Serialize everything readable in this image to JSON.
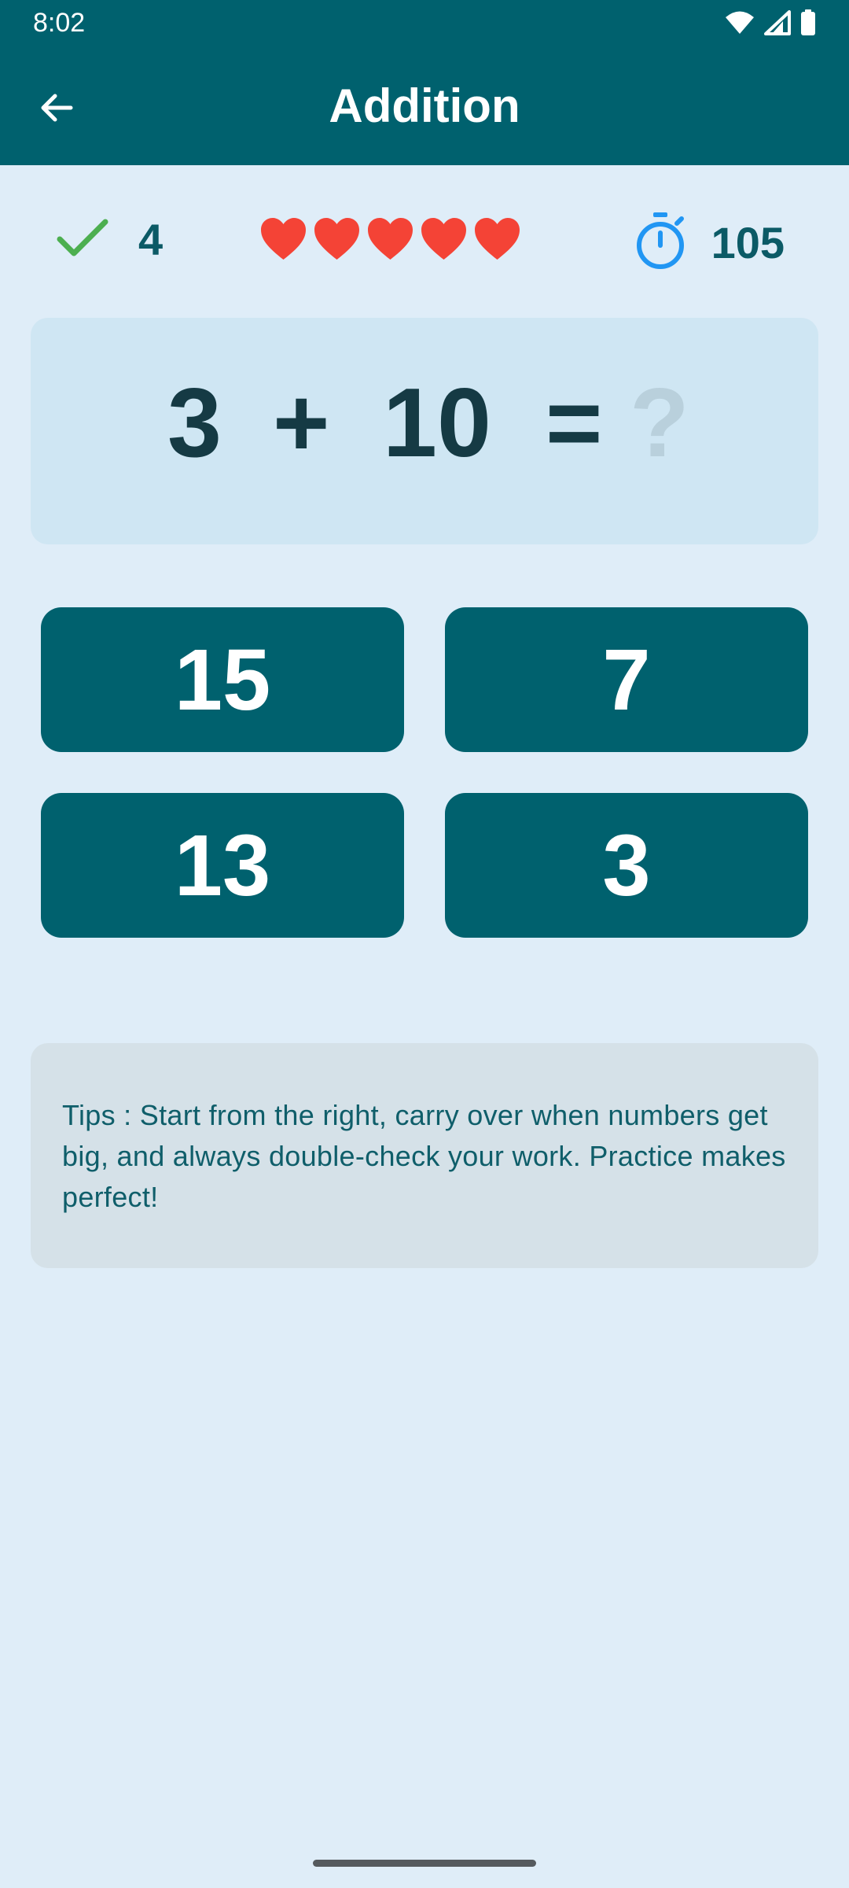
{
  "status_bar": {
    "time": "8:02",
    "icons": [
      "wifi-icon",
      "signal-icon",
      "battery-icon"
    ]
  },
  "app_bar": {
    "back_icon": "arrow-left-icon",
    "title": "Addition"
  },
  "stats": {
    "correct_icon": "check-icon",
    "correct_count": "4",
    "lives": 5,
    "heart_icon": "heart-icon",
    "timer_icon": "stopwatch-icon",
    "timer_value": "105"
  },
  "question": {
    "operand_a": "3",
    "operator": "+",
    "operand_b": "10",
    "equals": "=",
    "unknown": "?"
  },
  "answers": [
    "15",
    "7",
    "13",
    "3"
  ],
  "tips": {
    "text": "Tips : Start from the right, carry over when numbers get big, and always double-check your work. Practice makes perfect!"
  },
  "colors": {
    "primary": "#00616e",
    "background": "#dfedf8",
    "question_card": "#cfe6f3",
    "tips_card": "#d5e1e8",
    "heart": "#f44336",
    "check": "#4caf50",
    "timer": "#2196f3"
  }
}
